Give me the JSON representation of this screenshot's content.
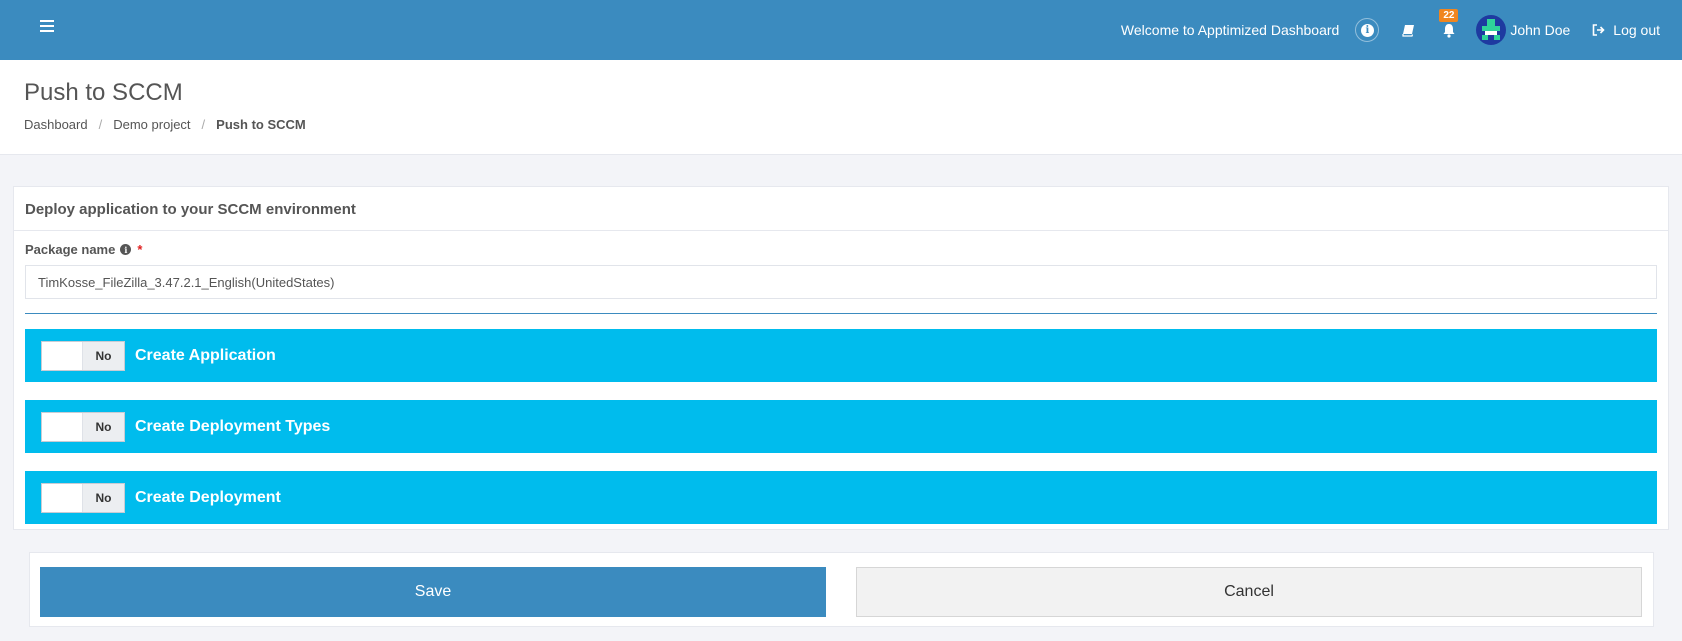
{
  "topbar": {
    "welcome": "Welcome to Apptimized Dashboard",
    "notification_count": "22",
    "user_name": "John Doe",
    "logout_label": "Log out",
    "icons": [
      "menu-icon",
      "info-icon",
      "book-icon",
      "bell-icon",
      "logout-icon"
    ]
  },
  "header": {
    "title": "Push to SCCM",
    "breadcrumb": [
      "Dashboard",
      "Demo project",
      "Push to SCCM"
    ],
    "separator": "/"
  },
  "panel": {
    "title": "Deploy application to your SCCM environment",
    "package_label": "Package name",
    "required_mark": "*",
    "package_value": "TimKosse_FileZilla_3.47.2.1_English(UnitedStates)",
    "sections": [
      {
        "label": "Create Application",
        "toggle": "No"
      },
      {
        "label": "Create Deployment Types",
        "toggle": "No"
      },
      {
        "label": "Create Deployment",
        "toggle": "No"
      }
    ]
  },
  "actions": {
    "save_label": "Save",
    "cancel_label": "Cancel"
  },
  "colors": {
    "primary": "#3b8bbf",
    "section_bar": "#00bced",
    "badge": "#f0861f"
  }
}
